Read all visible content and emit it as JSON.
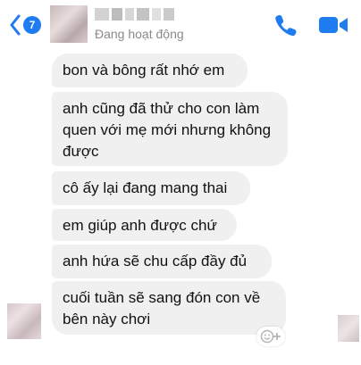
{
  "header": {
    "unread_count": "7",
    "status": "Đang hoạt động",
    "accent_color": "#1e7bf0"
  },
  "icons": {
    "back": "chevron-left-icon",
    "phone": "phone-icon",
    "video": "video-camera-icon",
    "reaction": "add-reaction-icon"
  },
  "messages": [
    {
      "text": "bon và bông rất nhớ em"
    },
    {
      "text": "anh cũng đã thử cho con làm quen với mẹ mới nhưng không được"
    },
    {
      "text": "cô ấy lại đang mang thai"
    },
    {
      "text": "em giúp anh được chứ"
    },
    {
      "text": "anh hứa sẽ chu cấp đầy đủ"
    },
    {
      "text": "cuối tuần sẽ sang đón con về bên này chơi"
    }
  ]
}
